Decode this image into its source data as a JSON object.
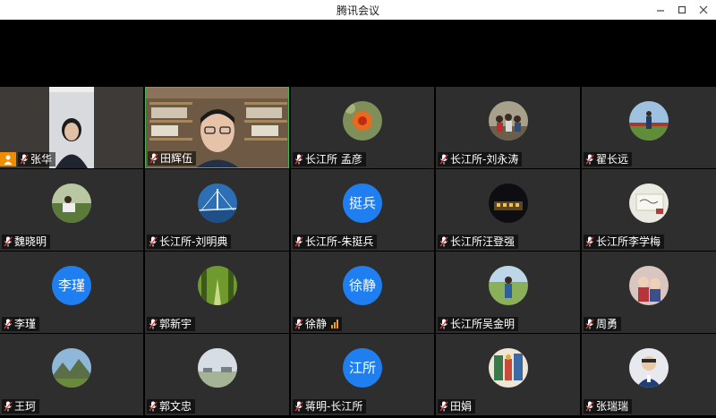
{
  "window": {
    "title": "腾讯会议"
  },
  "colors": {
    "tile_bg": "#2e2e2e",
    "avatar_blue": "#1f7ff0",
    "active_border": "#3fb94f",
    "host_badge": "#f08c00",
    "speaking_bars": "#f0a020"
  },
  "participants": [
    {
      "name": "张华",
      "type": "video",
      "host": true
    },
    {
      "name": "田辉伍",
      "type": "video",
      "active": true
    },
    {
      "name": "长江所 孟彦",
      "type": "photo",
      "icon": "flower-photo-icon"
    },
    {
      "name": "长江所-刘永涛",
      "type": "photo",
      "icon": "group-photo-icon"
    },
    {
      "name": "翟长远",
      "type": "photo",
      "icon": "person-outdoor-photo-icon"
    },
    {
      "name": "魏晓明",
      "type": "photo",
      "icon": "person-field-photo-icon"
    },
    {
      "name": "长江所-刘明典",
      "type": "photo",
      "icon": "bridge-photo-icon"
    },
    {
      "name": "长江所-朱挺兵",
      "type": "text",
      "avatar_text": "挺兵"
    },
    {
      "name": "长江所汪登强",
      "type": "photo",
      "icon": "night-building-photo-icon"
    },
    {
      "name": "长江所李学梅",
      "type": "photo",
      "icon": "card-photo-icon"
    },
    {
      "name": "李瑾",
      "type": "text",
      "avatar_text": "李瑾"
    },
    {
      "name": "郭新宇",
      "type": "photo",
      "icon": "forest-path-photo-icon"
    },
    {
      "name": "徐静",
      "type": "text",
      "avatar_text": "徐静",
      "speaking": true
    },
    {
      "name": "长江所吴金明",
      "type": "photo",
      "icon": "person-standing-photo-icon"
    },
    {
      "name": "周勇",
      "type": "photo",
      "icon": "couple-photo-icon"
    },
    {
      "name": "王珂",
      "type": "photo",
      "icon": "mountain-photo-icon"
    },
    {
      "name": "郭文忠",
      "type": "photo",
      "icon": "landscape-photo-icon"
    },
    {
      "name": "蒋明-长江所",
      "type": "text",
      "avatar_text": "江所"
    },
    {
      "name": "田娟",
      "type": "photo",
      "icon": "painting-photo-icon"
    },
    {
      "name": "张瑞瑞",
      "type": "photo",
      "icon": "person-portrait-photo-icon"
    }
  ]
}
